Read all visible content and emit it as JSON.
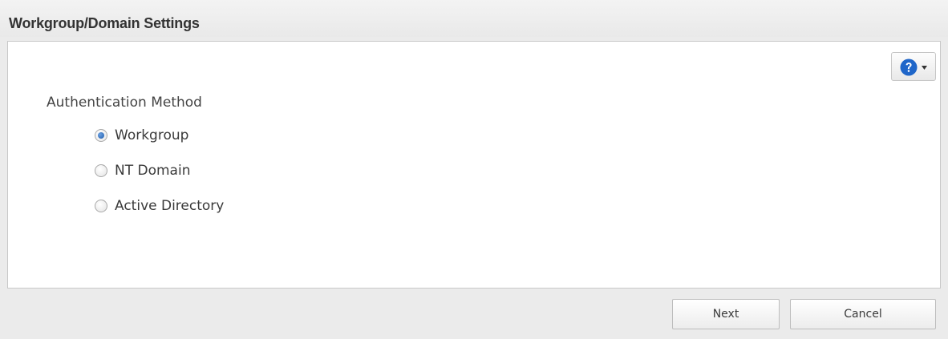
{
  "dialog": {
    "title": "Workgroup/Domain Settings"
  },
  "help": {
    "icon": "question-mark-icon",
    "dropdown_icon": "caret-down-icon",
    "icon_color": "#1f66c9"
  },
  "auth": {
    "label": "Authentication Method",
    "selected": "Workgroup",
    "options": [
      {
        "label": "Workgroup",
        "checked": true
      },
      {
        "label": "NT Domain",
        "checked": false
      },
      {
        "label": "Active Directory",
        "checked": false
      }
    ]
  },
  "footer": {
    "next_label": "Next",
    "cancel_label": "Cancel"
  }
}
